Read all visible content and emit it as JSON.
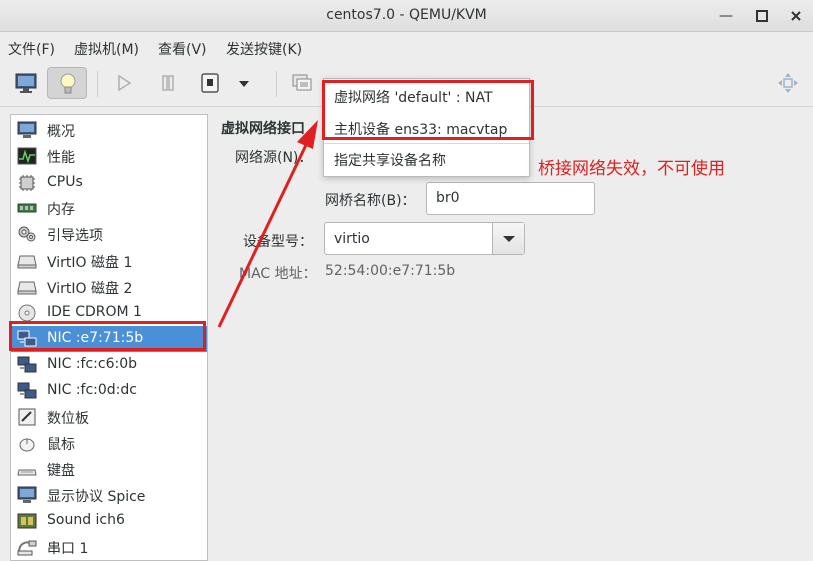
{
  "window": {
    "title": "centos7.0 - QEMU/KVM",
    "minimize": "—",
    "maximize": "◻",
    "close": "✕"
  },
  "menubar": {
    "items": [
      "文件(F)",
      "虚拟机(M)",
      "查看(V)",
      "发送按键(K)"
    ]
  },
  "toolbar": {
    "icons": [
      "monitor-icon",
      "lightbulb-icon",
      "play-icon",
      "pause-icon",
      "stop-icon",
      "dropdown-arrow-icon",
      "snapshot-icon",
      "fullscreen-icon"
    ]
  },
  "sidebar": {
    "items": [
      {
        "label": "概况",
        "icon": "overview-icon"
      },
      {
        "label": "性能",
        "icon": "performance-icon"
      },
      {
        "label": "CPUs",
        "icon": "cpu-icon"
      },
      {
        "label": "内存",
        "icon": "memory-icon"
      },
      {
        "label": "引导选项",
        "icon": "boot-options-icon"
      },
      {
        "label": "VirtIO 磁盘 1",
        "icon": "disk-icon"
      },
      {
        "label": "VirtIO 磁盘 2",
        "icon": "disk-icon"
      },
      {
        "label": "IDE CDROM 1",
        "icon": "cdrom-icon"
      },
      {
        "label": "NIC :e7:71:5b",
        "icon": "nic-icon",
        "selected": true
      },
      {
        "label": "NIC :fc:c6:0b",
        "icon": "nic-icon"
      },
      {
        "label": "NIC :fc:0d:dc",
        "icon": "nic-icon"
      },
      {
        "label": "数位板",
        "icon": "tablet-icon"
      },
      {
        "label": "鼠标",
        "icon": "mouse-icon"
      },
      {
        "label": "键盘",
        "icon": "keyboard-icon"
      },
      {
        "label": "显示协议 Spice",
        "icon": "display-icon"
      },
      {
        "label": "Sound ich6",
        "icon": "sound-icon"
      },
      {
        "label": "串口 1",
        "icon": "serial-icon"
      }
    ]
  },
  "details": {
    "section_title": "虚拟网络接口",
    "network_source_label": "网络源(N)：",
    "bridge_name_label": "网桥名称(B)：",
    "bridge_name_value": "br0",
    "device_model_label": "设备型号：",
    "device_model_value": "virtio",
    "mac_label": "MAC 地址：",
    "mac_value": "52:54:00:e7:71:5b"
  },
  "dropdown": {
    "options": [
      "虚拟网络  'default' : NAT",
      "主机设备  ens33: macvtap",
      "指定共享设备名称"
    ]
  },
  "annotation": {
    "text": "桥接网络失效，不可使用",
    "color": "#e02020"
  },
  "colors": {
    "selection": "#4a90d9",
    "annotation_red": "#e02020"
  }
}
